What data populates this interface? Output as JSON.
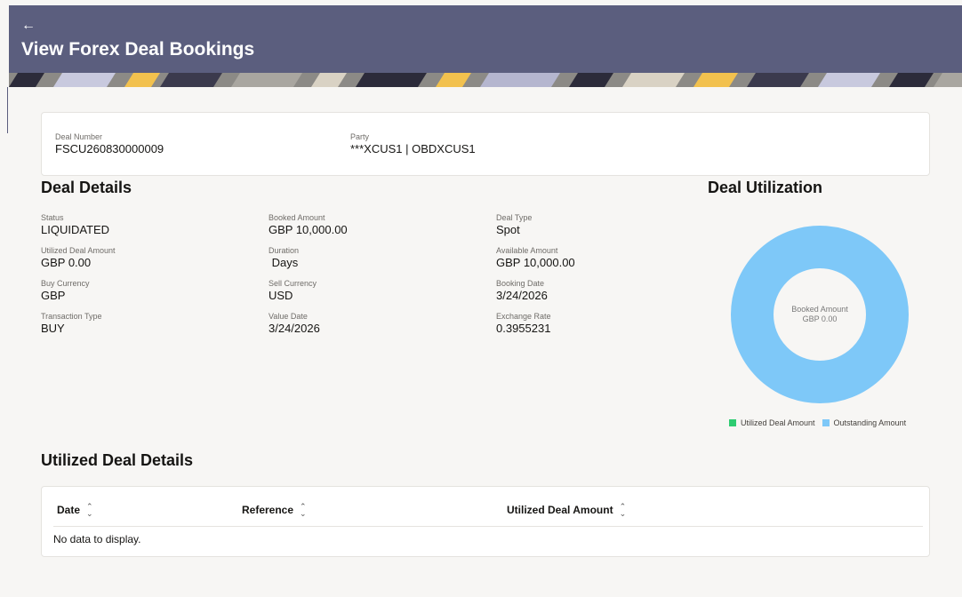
{
  "header": {
    "back_icon": "←",
    "title": "View Forex Deal Bookings"
  },
  "summary": {
    "deal_number": {
      "label": "Deal Number",
      "value": "FSCU260830000009"
    },
    "party": {
      "label": "Party",
      "value": "***XCUS1 | OBDXCUS1"
    }
  },
  "deal_details": {
    "title": "Deal Details",
    "status": {
      "label": "Status",
      "value": "LIQUIDATED"
    },
    "booked_amount": {
      "label": "Booked Amount",
      "value": "GBP 10,000.00"
    },
    "deal_type": {
      "label": "Deal Type",
      "value": "Spot"
    },
    "utilized_deal_amount": {
      "label": "Utilized Deal Amount",
      "value": "GBP 0.00"
    },
    "duration": {
      "label": "Duration",
      "value": " Days"
    },
    "available_amount": {
      "label": "Available Amount",
      "value": "GBP 10,000.00"
    },
    "buy_currency": {
      "label": "Buy Currency",
      "value": "GBP"
    },
    "sell_currency": {
      "label": "Sell Currency",
      "value": "USD"
    },
    "booking_date": {
      "label": "Booking Date",
      "value": "3/24/2026"
    },
    "transaction_type": {
      "label": "Transaction Type",
      "value": "BUY"
    },
    "value_date": {
      "label": "Value Date",
      "value": "3/24/2026"
    },
    "exchange_rate": {
      "label": "Exchange Rate",
      "value": "0.3955231"
    }
  },
  "deal_utilization": {
    "title": "Deal Utilization",
    "center_label": "Booked Amount",
    "center_value": "GBP 0.00",
    "legend": [
      {
        "label": "Utilized Deal Amount",
        "color": "#2ecc71"
      },
      {
        "label": "Outstanding Amount",
        "color": "#7ec8f8"
      }
    ]
  },
  "chart_data": {
    "type": "pie",
    "categories": [
      "Utilized Deal Amount",
      "Outstanding Amount"
    ],
    "values": [
      0,
      10000
    ],
    "colors": [
      "#2ecc71",
      "#7ec8f8"
    ],
    "title": "Deal Utilization",
    "center_label": "Booked Amount",
    "center_value": "GBP 0.00",
    "legend_position": "bottom-right"
  },
  "utilized_deal_details": {
    "title": "Utilized Deal Details",
    "columns": [
      "Date",
      "Reference",
      "Utilized Deal Amount"
    ],
    "sort_icon": "sort-icon",
    "empty_message": "No data to display."
  },
  "colors": {
    "header_bg": "#5b5e7e",
    "page_bg": "#f7f6f4",
    "donut": "#7ec8f8",
    "utilized": "#2ecc71"
  }
}
